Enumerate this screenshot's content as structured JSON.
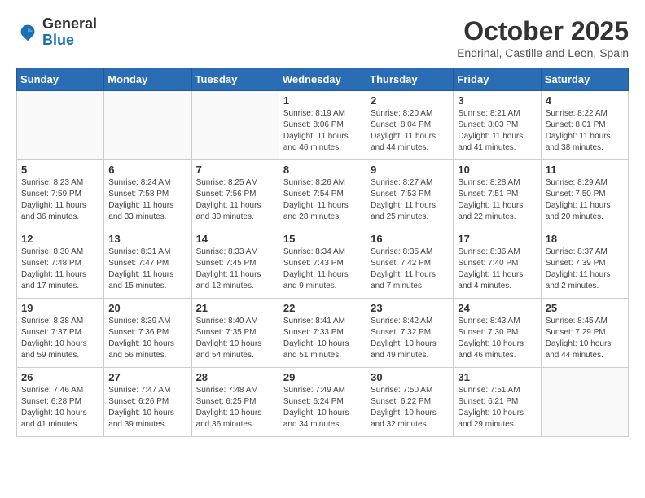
{
  "header": {
    "logo_general": "General",
    "logo_blue": "Blue",
    "month_year": "October 2025",
    "location": "Endrinal, Castille and Leon, Spain"
  },
  "days_of_week": [
    "Sunday",
    "Monday",
    "Tuesday",
    "Wednesday",
    "Thursday",
    "Friday",
    "Saturday"
  ],
  "weeks": [
    [
      {
        "day": "",
        "info": ""
      },
      {
        "day": "",
        "info": ""
      },
      {
        "day": "",
        "info": ""
      },
      {
        "day": "1",
        "info": "Sunrise: 8:19 AM\nSunset: 8:06 PM\nDaylight: 11 hours\nand 46 minutes."
      },
      {
        "day": "2",
        "info": "Sunrise: 8:20 AM\nSunset: 8:04 PM\nDaylight: 11 hours\nand 44 minutes."
      },
      {
        "day": "3",
        "info": "Sunrise: 8:21 AM\nSunset: 8:03 PM\nDaylight: 11 hours\nand 41 minutes."
      },
      {
        "day": "4",
        "info": "Sunrise: 8:22 AM\nSunset: 8:01 PM\nDaylight: 11 hours\nand 38 minutes."
      }
    ],
    [
      {
        "day": "5",
        "info": "Sunrise: 8:23 AM\nSunset: 7:59 PM\nDaylight: 11 hours\nand 36 minutes."
      },
      {
        "day": "6",
        "info": "Sunrise: 8:24 AM\nSunset: 7:58 PM\nDaylight: 11 hours\nand 33 minutes."
      },
      {
        "day": "7",
        "info": "Sunrise: 8:25 AM\nSunset: 7:56 PM\nDaylight: 11 hours\nand 30 minutes."
      },
      {
        "day": "8",
        "info": "Sunrise: 8:26 AM\nSunset: 7:54 PM\nDaylight: 11 hours\nand 28 minutes."
      },
      {
        "day": "9",
        "info": "Sunrise: 8:27 AM\nSunset: 7:53 PM\nDaylight: 11 hours\nand 25 minutes."
      },
      {
        "day": "10",
        "info": "Sunrise: 8:28 AM\nSunset: 7:51 PM\nDaylight: 11 hours\nand 22 minutes."
      },
      {
        "day": "11",
        "info": "Sunrise: 8:29 AM\nSunset: 7:50 PM\nDaylight: 11 hours\nand 20 minutes."
      }
    ],
    [
      {
        "day": "12",
        "info": "Sunrise: 8:30 AM\nSunset: 7:48 PM\nDaylight: 11 hours\nand 17 minutes."
      },
      {
        "day": "13",
        "info": "Sunrise: 8:31 AM\nSunset: 7:47 PM\nDaylight: 11 hours\nand 15 minutes."
      },
      {
        "day": "14",
        "info": "Sunrise: 8:33 AM\nSunset: 7:45 PM\nDaylight: 11 hours\nand 12 minutes."
      },
      {
        "day": "15",
        "info": "Sunrise: 8:34 AM\nSunset: 7:43 PM\nDaylight: 11 hours\nand 9 minutes."
      },
      {
        "day": "16",
        "info": "Sunrise: 8:35 AM\nSunset: 7:42 PM\nDaylight: 11 hours\nand 7 minutes."
      },
      {
        "day": "17",
        "info": "Sunrise: 8:36 AM\nSunset: 7:40 PM\nDaylight: 11 hours\nand 4 minutes."
      },
      {
        "day": "18",
        "info": "Sunrise: 8:37 AM\nSunset: 7:39 PM\nDaylight: 11 hours\nand 2 minutes."
      }
    ],
    [
      {
        "day": "19",
        "info": "Sunrise: 8:38 AM\nSunset: 7:37 PM\nDaylight: 10 hours\nand 59 minutes."
      },
      {
        "day": "20",
        "info": "Sunrise: 8:39 AM\nSunset: 7:36 PM\nDaylight: 10 hours\nand 56 minutes."
      },
      {
        "day": "21",
        "info": "Sunrise: 8:40 AM\nSunset: 7:35 PM\nDaylight: 10 hours\nand 54 minutes."
      },
      {
        "day": "22",
        "info": "Sunrise: 8:41 AM\nSunset: 7:33 PM\nDaylight: 10 hours\nand 51 minutes."
      },
      {
        "day": "23",
        "info": "Sunrise: 8:42 AM\nSunset: 7:32 PM\nDaylight: 10 hours\nand 49 minutes."
      },
      {
        "day": "24",
        "info": "Sunrise: 8:43 AM\nSunset: 7:30 PM\nDaylight: 10 hours\nand 46 minutes."
      },
      {
        "day": "25",
        "info": "Sunrise: 8:45 AM\nSunset: 7:29 PM\nDaylight: 10 hours\nand 44 minutes."
      }
    ],
    [
      {
        "day": "26",
        "info": "Sunrise: 7:46 AM\nSunset: 6:28 PM\nDaylight: 10 hours\nand 41 minutes."
      },
      {
        "day": "27",
        "info": "Sunrise: 7:47 AM\nSunset: 6:26 PM\nDaylight: 10 hours\nand 39 minutes."
      },
      {
        "day": "28",
        "info": "Sunrise: 7:48 AM\nSunset: 6:25 PM\nDaylight: 10 hours\nand 36 minutes."
      },
      {
        "day": "29",
        "info": "Sunrise: 7:49 AM\nSunset: 6:24 PM\nDaylight: 10 hours\nand 34 minutes."
      },
      {
        "day": "30",
        "info": "Sunrise: 7:50 AM\nSunset: 6:22 PM\nDaylight: 10 hours\nand 32 minutes."
      },
      {
        "day": "31",
        "info": "Sunrise: 7:51 AM\nSunset: 6:21 PM\nDaylight: 10 hours\nand 29 minutes."
      },
      {
        "day": "",
        "info": ""
      }
    ]
  ]
}
